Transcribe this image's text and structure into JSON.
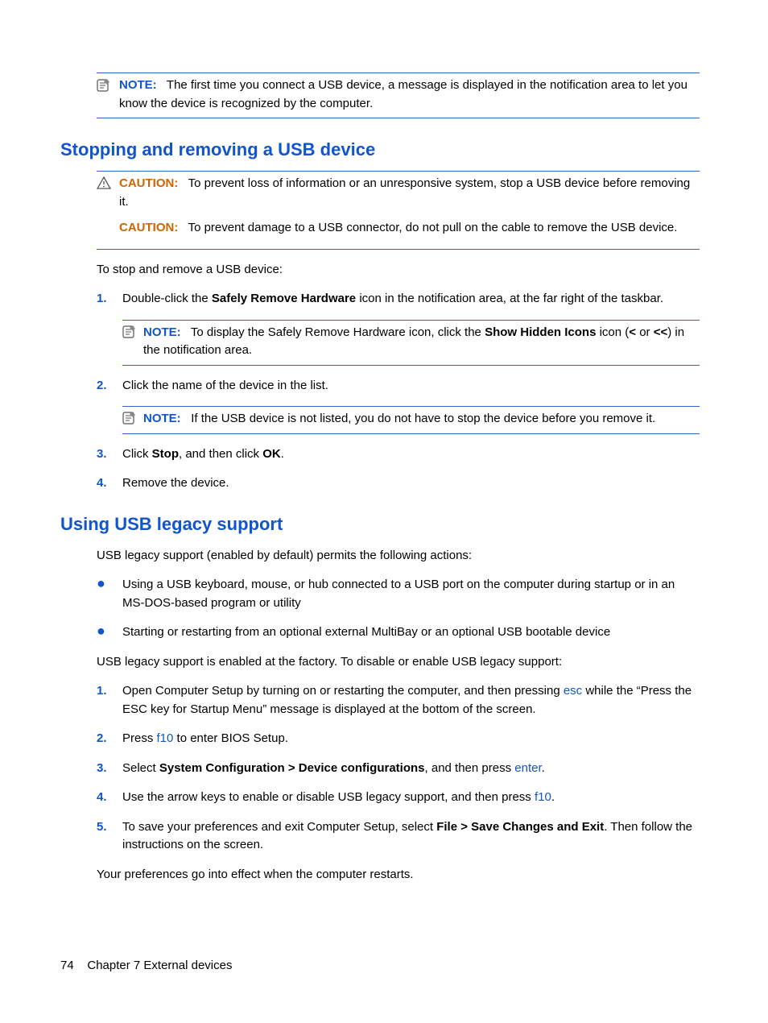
{
  "topNote": {
    "label": "NOTE:",
    "text": "The first time you connect a USB device, a message is displayed in the notification area to let you know the device is recognized by the computer."
  },
  "section1": {
    "heading": "Stopping and removing a USB device",
    "caution1": {
      "label": "CAUTION:",
      "text": "To prevent loss of information or an unresponsive system, stop a USB device before removing it."
    },
    "caution2": {
      "label": "CAUTION:",
      "text": "To prevent damage to a USB connector, do not pull on the cable to remove the USB device."
    },
    "intro": "To stop and remove a USB device:",
    "step1": {
      "num": "1.",
      "pre": "Double-click the ",
      "b1": "Safely Remove Hardware",
      "post": " icon in the notification area, at the far right of the taskbar."
    },
    "note1": {
      "label": "NOTE:",
      "pre": "To display the Safely Remove Hardware icon, click the ",
      "b1": "Show Hidden Icons",
      "mid": " icon (",
      "b2": "<",
      "or": " or ",
      "b3": "<<",
      "post": ") in the notification area."
    },
    "step2": {
      "num": "2.",
      "text": "Click the name of the device in the list."
    },
    "note2": {
      "label": "NOTE:",
      "text": "If the USB device is not listed, you do not have to stop the device before you remove it."
    },
    "step3": {
      "num": "3.",
      "pre": "Click ",
      "b1": "Stop",
      "mid": ", and then click ",
      "b2": "OK",
      "post": "."
    },
    "step4": {
      "num": "4.",
      "text": "Remove the device."
    }
  },
  "section2": {
    "heading": "Using USB legacy support",
    "intro": "USB legacy support (enabled by default) permits the following actions:",
    "bullet1": "Using a USB keyboard, mouse, or hub connected to a USB port on the computer during startup or in an MS-DOS-based program or utility",
    "bullet2": "Starting or restarting from an optional external MultiBay or an optional USB bootable device",
    "para2": "USB legacy support is enabled at the factory. To disable or enable USB legacy support:",
    "step1": {
      "num": "1.",
      "pre": "Open Computer Setup by turning on or restarting the computer, and then pressing ",
      "k1": "esc",
      "post": " while the “Press the ESC key for Startup Menu” message is displayed at the bottom of the screen."
    },
    "step2": {
      "num": "2.",
      "pre": "Press ",
      "k1": "f10",
      "post": " to enter BIOS Setup."
    },
    "step3": {
      "num": "3.",
      "pre": "Select ",
      "b1": "System Configuration > Device configurations",
      "mid": ", and then press ",
      "k1": "enter",
      "post": "."
    },
    "step4": {
      "num": "4.",
      "pre": "Use the arrow keys to enable or disable USB legacy support, and then press ",
      "k1": "f10",
      "post": "."
    },
    "step5": {
      "num": "5.",
      "pre": "To save your preferences and exit Computer Setup, select ",
      "b1": "File > Save Changes and Exit",
      "post": ". Then follow the instructions on the screen."
    },
    "closing": "Your preferences go into effect when the computer restarts."
  },
  "footer": {
    "page": "74",
    "chapter": "Chapter 7   External devices"
  }
}
